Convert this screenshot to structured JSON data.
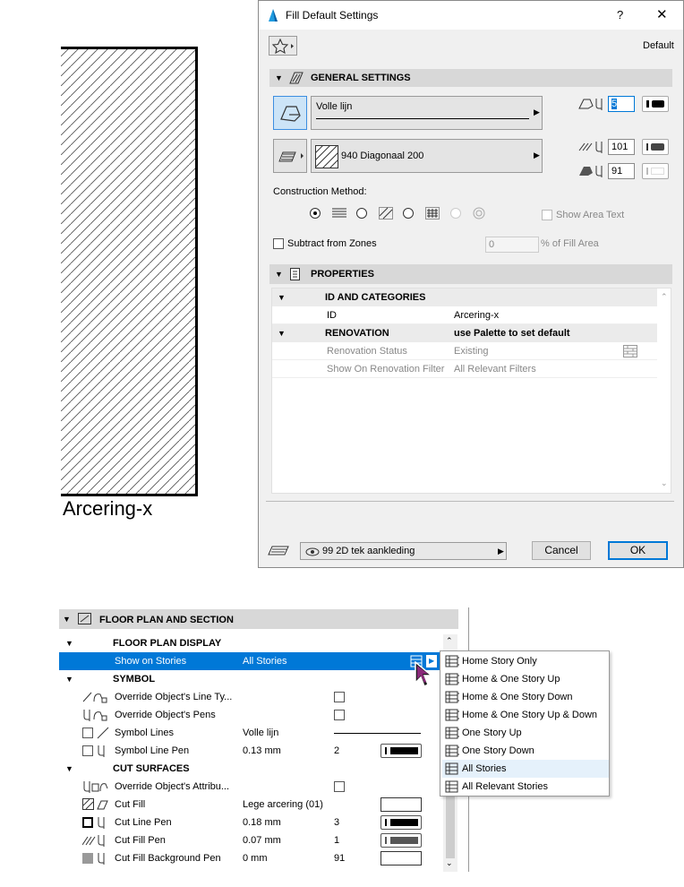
{
  "drawing": {
    "caption": "Arcering-x"
  },
  "dialog": {
    "title": "Fill Default Settings",
    "help": "?",
    "close": "✕",
    "default_label": "Default",
    "general_settings": "GENERAL SETTINGS",
    "line_type": "Volle lijn",
    "fill_type": "940 Diagonaal 200",
    "pen_contour": "5",
    "pen_fill": "101",
    "pen_background": "91",
    "construction_method": "Construction Method:",
    "show_area_text": "Show Area Text",
    "subtract_from_zones": "Subtract from Zones",
    "fill_area_value": "0",
    "fill_area_unit": "% of Fill Area",
    "properties": "PROPERTIES",
    "id_categories": "ID AND CATEGORIES",
    "id_label": "ID",
    "id_value": "Arcering-x",
    "renovation": "RENOVATION",
    "renovation_value": "use Palette to set default",
    "renovation_status": "Renovation Status",
    "renovation_status_value": "Existing",
    "show_on_filter": "Show On Renovation Filter",
    "show_on_filter_value": "All Relevant Filters",
    "layer": "99 2D tek aankleding",
    "cancel": "Cancel",
    "ok": "OK"
  },
  "panel": {
    "header": "FLOOR PLAN AND SECTION",
    "floor_plan_display": "FLOOR PLAN DISPLAY",
    "show_on_stories": "Show on Stories",
    "show_on_stories_value": "All Stories",
    "symbol": "SYMBOL",
    "override_line_types": "Override Object's Line Ty...",
    "override_pens": "Override Object's Pens",
    "symbol_lines": "Symbol Lines",
    "symbol_lines_value": "Volle lijn",
    "symbol_line_pen": "Symbol Line Pen",
    "symbol_line_pen_mm": "0.13 mm",
    "symbol_line_pen_num": "2",
    "cut_surfaces": "CUT SURFACES",
    "override_attributes": "Override Object's Attribu...",
    "cut_fill": "Cut Fill",
    "cut_fill_value": "Lege arcering (01)",
    "cut_line_pen": "Cut Line Pen",
    "cut_line_pen_mm": "0.18 mm",
    "cut_line_pen_num": "3",
    "cut_fill_pen": "Cut Fill Pen",
    "cut_fill_pen_mm": "0.07 mm",
    "cut_fill_pen_num": "1",
    "cut_fill_bg_pen": "Cut Fill Background Pen",
    "cut_fill_bg_pen_mm": "0 mm",
    "cut_fill_bg_pen_num": "91"
  },
  "popup": {
    "items": [
      "Home Story Only",
      "Home & One Story Up",
      "Home & One Story Down",
      "Home & One Story Up & Down",
      "One Story Up",
      "One Story Down",
      "All Stories",
      "All Relevant Stories"
    ]
  },
  "colors": {
    "selection": "#0078d7",
    "ok_border": "#0078d7"
  }
}
